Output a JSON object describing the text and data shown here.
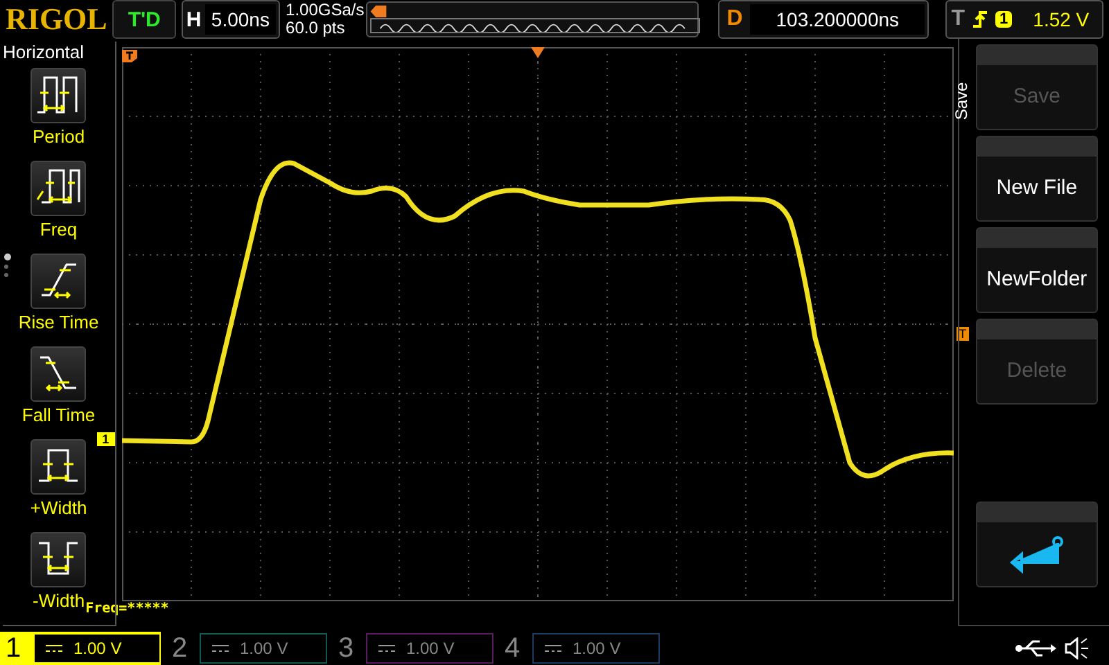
{
  "brand": "RIGOL",
  "run_status": "T'D",
  "horizontal": {
    "label": "H",
    "timebase": "5.00ns"
  },
  "sample": {
    "rate": "1.00GSa/s",
    "points": "60.0 pts"
  },
  "delay": {
    "label": "D",
    "value": "103.200000ns"
  },
  "trigger": {
    "label": "T",
    "source": "1",
    "level": "1.52 V"
  },
  "measure_menu": {
    "title": "Horizontal",
    "items": [
      {
        "label": "Period",
        "kind": "period"
      },
      {
        "label": "Freq",
        "kind": "freq"
      },
      {
        "label": "Rise Time",
        "kind": "rise"
      },
      {
        "label": "Fall Time",
        "kind": "fall"
      },
      {
        "label": "+Width",
        "kind": "pwidth"
      },
      {
        "label": "-Width",
        "kind": "nwidth"
      }
    ],
    "pages": [
      {
        "selected": true
      },
      {
        "selected": false
      },
      {
        "selected": false
      }
    ]
  },
  "channel_marker": "1",
  "trigger_level_marker": "T",
  "measurement": "Freq=*****",
  "softkey_menu": {
    "title": "Save",
    "buttons": [
      {
        "kind": "text",
        "label": "Save",
        "disabled": true
      },
      {
        "kind": "text",
        "label": "New File",
        "disabled": false
      },
      {
        "kind": "text",
        "label": "NewFolder",
        "disabled": false
      },
      {
        "kind": "text",
        "label": "Delete",
        "disabled": true
      },
      {
        "kind": "spacer"
      },
      {
        "kind": "back"
      }
    ]
  },
  "channels": [
    {
      "number": "1",
      "scale": "1.00 V",
      "selected": true,
      "color": "#ffff00"
    },
    {
      "number": "2",
      "scale": "1.00 V",
      "selected": false,
      "color": "#0e5a55"
    },
    {
      "number": "3",
      "scale": "1.00 V",
      "selected": false,
      "color": "#5a1a5e"
    },
    {
      "number": "4",
      "scale": "1.00 V",
      "selected": false,
      "color": "#1a3a5e"
    }
  ]
}
